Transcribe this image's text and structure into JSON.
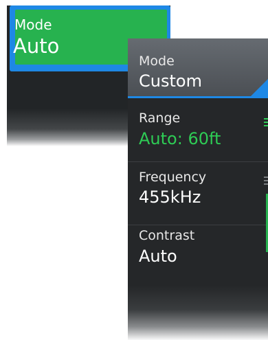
{
  "auto_panel": {
    "mode_label": "Mode",
    "mode_value": "Auto"
  },
  "custom_panel": {
    "mode_label": "Mode",
    "mode_value": "Custom",
    "rows": [
      {
        "label": "Range",
        "value": "Auto: 60ft"
      },
      {
        "label": "Frequency",
        "value": "455kHz"
      },
      {
        "label": "Contrast",
        "value": "Auto"
      }
    ]
  },
  "colors": {
    "selection_blue": "#1e88e5",
    "active_green": "#27b24f",
    "value_green": "#2ecc55",
    "panel_dark": "#252729"
  }
}
